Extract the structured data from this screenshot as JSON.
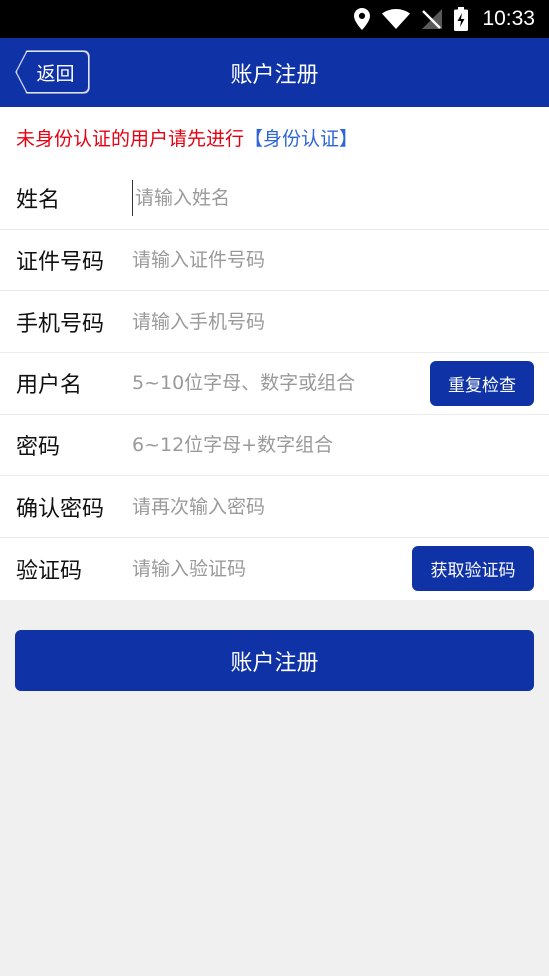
{
  "status_bar": {
    "time": "10:33",
    "icons": [
      "location-icon",
      "wifi-icon",
      "no-signal-icon",
      "battery-charging-icon"
    ]
  },
  "header": {
    "back_label": "返回",
    "title": "账户注册"
  },
  "notice": {
    "text": "未身份认证的用户请先进行",
    "link_text": "【身份认证】"
  },
  "form": {
    "rows": [
      {
        "label": "姓名",
        "placeholder": "请输入姓名",
        "value": ""
      },
      {
        "label": "证件号码",
        "placeholder": "请输入证件号码",
        "value": ""
      },
      {
        "label": "手机号码",
        "placeholder": "请输入手机号码",
        "value": ""
      },
      {
        "label": "用户名",
        "placeholder": "5~10位字母、数字或组合",
        "value": "",
        "button": "重复检查"
      },
      {
        "label": "密码",
        "placeholder": "6~12位字母+数字组合",
        "value": ""
      },
      {
        "label": "确认密码",
        "placeholder": "请再次输入密码",
        "value": ""
      },
      {
        "label": "验证码",
        "placeholder": "请输入验证码",
        "value": "",
        "button": "获取验证码"
      }
    ]
  },
  "submit_label": "账户注册",
  "colors": {
    "primary": "#0f33a6",
    "notice_red": "#e60012",
    "link_blue": "#2e66d8",
    "background": "#f0f0f0"
  }
}
